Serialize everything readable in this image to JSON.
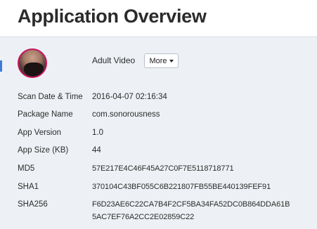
{
  "header": {
    "title": "Application Overview"
  },
  "app": {
    "name": "Adult Video",
    "more_label": "More"
  },
  "details": {
    "scan_date": {
      "label": "Scan Date & Time",
      "value": "2016-04-07 02:16:34"
    },
    "package_name": {
      "label": "Package Name",
      "value": "com.sonorousness"
    },
    "app_version": {
      "label": "App Version",
      "value": "1.0"
    },
    "app_size": {
      "label": "App Size (KB)",
      "value": "44"
    },
    "md5": {
      "label": "MD5",
      "value": "57E217E4C46F45A27C0F7E5118718771"
    },
    "sha1": {
      "label": "SHA1",
      "value": "370104C43BF055C6B221807FB55BE440139FEF91"
    },
    "sha256": {
      "label": "SHA256",
      "value_line1": "F6D23AE6C22CA7B4F2CF5BA34FA52DC0B864DDA61B",
      "value_line2": "5AC7EF76A2CC2E02859C22"
    }
  },
  "colors": {
    "panel_background": "#edf1f5",
    "avatar_border": "#c5165e",
    "side_tab": "#3d7bd9"
  },
  "icons": {
    "more_caret": "caret-down-icon",
    "avatar": "app-avatar-image"
  }
}
